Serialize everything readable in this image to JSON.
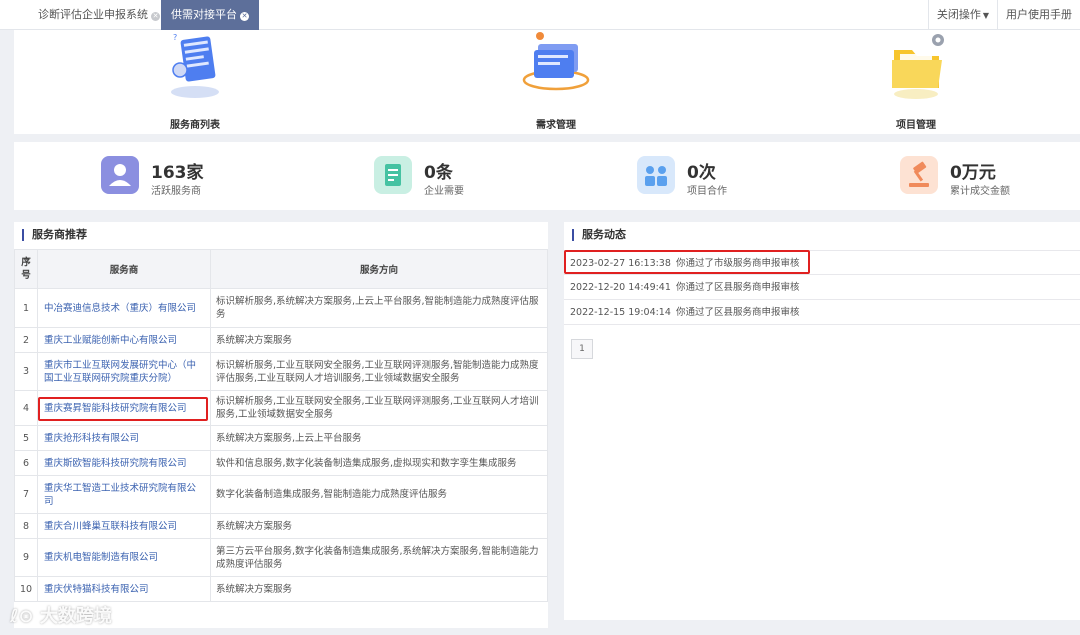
{
  "tabs": [
    {
      "label": "诊断评估企业申报系统",
      "active": false
    },
    {
      "label": "供需对接平台",
      "active": true
    }
  ],
  "top_actions": {
    "close_ops": "关闭操作",
    "manual": "用户使用手册"
  },
  "features": [
    {
      "label": "服务商列表",
      "icon": "provider-list-icon"
    },
    {
      "label": "需求管理",
      "icon": "demand-management-icon"
    },
    {
      "label": "项目管理",
      "icon": "project-folder-icon"
    }
  ],
  "stats": [
    {
      "value": "163家",
      "label": "活跃服务商",
      "icon": "user-icon",
      "color": "#7a7fdc"
    },
    {
      "value": "0条",
      "label": "企业需要",
      "icon": "document-edit-icon",
      "color": "#45c2a2"
    },
    {
      "value": "0次",
      "label": "项目合作",
      "icon": "people-icon",
      "color": "#5aa0ee"
    },
    {
      "value": "0万元",
      "label": "累计成交金额",
      "icon": "gavel-icon",
      "color": "#f08a5b"
    }
  ],
  "providers": {
    "title": "服务商推荐",
    "headers": {
      "idx": "序号",
      "company": "服务商",
      "direction": "服务方向"
    },
    "rows": [
      {
        "idx": "1",
        "company": "中冶赛迪信息技术（重庆）有限公司",
        "direction": "标识解析服务,系统解决方案服务,上云上平台服务,智能制造能力成熟度评估服务"
      },
      {
        "idx": "2",
        "company": "重庆工业赋能创新中心有限公司",
        "direction": "系统解决方案服务"
      },
      {
        "idx": "3",
        "company": "重庆市工业互联网发展研究中心（中国工业互联网研究院重庆分院）",
        "direction": "标识解析服务,工业互联网安全服务,工业互联网评测服务,智能制造能力成熟度评估服务,工业互联网人才培训服务,工业领域数据安全服务"
      },
      {
        "idx": "4",
        "company": "重庆赛昇智能科技研究院有限公司",
        "direction": "标识解析服务,工业互联网安全服务,工业互联网评测服务,工业互联网人才培训服务,工业领域数据安全服务"
      },
      {
        "idx": "5",
        "company": "重庆抢形科技有限公司",
        "direction": "系统解决方案服务,上云上平台服务"
      },
      {
        "idx": "6",
        "company": "重庆斯欧智能科技研究院有限公司",
        "direction": "软件和信息服务,数字化装备制造集成服务,虚拟现实和数字孪生集成服务"
      },
      {
        "idx": "7",
        "company": "重庆华工智造工业技术研究院有限公司",
        "direction": "数字化装备制造集成服务,智能制造能力成熟度评估服务"
      },
      {
        "idx": "8",
        "company": "重庆合川蜂巢互联科技有限公司",
        "direction": "系统解决方案服务"
      },
      {
        "idx": "9",
        "company": "重庆机电智能制造有限公司",
        "direction": "第三方云平台服务,数字化装备制造集成服务,系统解决方案服务,智能制造能力成熟度评估服务"
      },
      {
        "idx": "10",
        "company": "重庆伏特猫科技有限公司",
        "direction": "系统解决方案服务"
      }
    ]
  },
  "feed": {
    "title": "服务动态",
    "items": [
      {
        "time": "2023-02-27 16:13:38",
        "message": "你通过了市级服务商申报审核"
      },
      {
        "time": "2022-12-20 14:49:41",
        "message": "你通过了区县服务商申报审核"
      },
      {
        "time": "2022-12-15 19:04:14",
        "message": "你通过了区县服务商申报审核"
      }
    ],
    "page": "1"
  },
  "watermark": "大数跨境",
  "accent": "#5d6f9a",
  "highlight": "#e02020"
}
